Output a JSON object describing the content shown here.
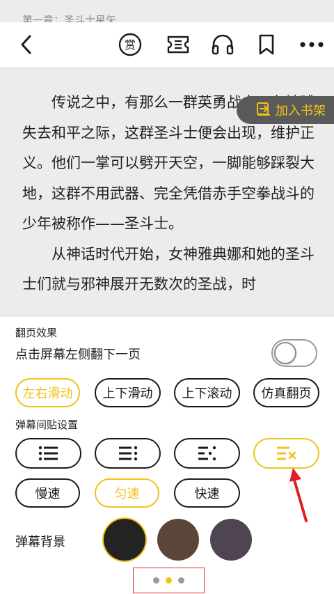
{
  "chapter_title": "第一章：圣斗士星矢",
  "toolbar": {
    "back_icon": "chevron-left-icon",
    "reward_icon": "reward-icon",
    "reward_char": "赏",
    "ticket_icon": "ticket-icon",
    "audio_icon": "headphones-icon",
    "bookmark_icon": "bookmark-icon",
    "more_icon": "more-horizontal-icon"
  },
  "article": {
    "paragraph1": "　　传说之中，有那么一群英勇战士，在地球失去和平之际，这群圣斗士便会出现，维护正义。他们一掌可以劈开天空，一脚能够踩裂大地，这群不用武器、完全凭借赤手空拳战斗的少年被称作——圣斗士。",
    "paragraph2": "　　从神话时代开始，女神雅典娜和她的圣斗士们就与邪神展开无数次的圣战，时"
  },
  "shelf_button": {
    "label": "加入书架",
    "icon": "add-to-shelf-icon"
  },
  "page_turn": {
    "section_title": "翻页效果",
    "tap_left_label": "点击屏幕左侧翻下一页",
    "tap_left_enabled": false,
    "options": [
      "左右滑动",
      "上下滑动",
      "上下滚动",
      "仿真翻页"
    ],
    "selected": "左右滑动"
  },
  "danmaku": {
    "section_title": "弹幕间贴设置",
    "density_options": [
      "dense-list-icon",
      "medium-list-icon",
      "sparse-list-icon",
      "danmaku-off-icon"
    ],
    "density_selected": "danmaku-off-icon",
    "speed_options": [
      "慢速",
      "匀速",
      "快速"
    ],
    "speed_selected": "匀速",
    "background_label": "弹幕背景",
    "background_colors": [
      "#232323",
      "#5a4538",
      "#4e4452"
    ],
    "background_selected": "#232323"
  },
  "pager": {
    "pages": 3,
    "current": 2
  },
  "colors": {
    "accent": "#f1c21b",
    "highlight_box": "#e03030"
  }
}
